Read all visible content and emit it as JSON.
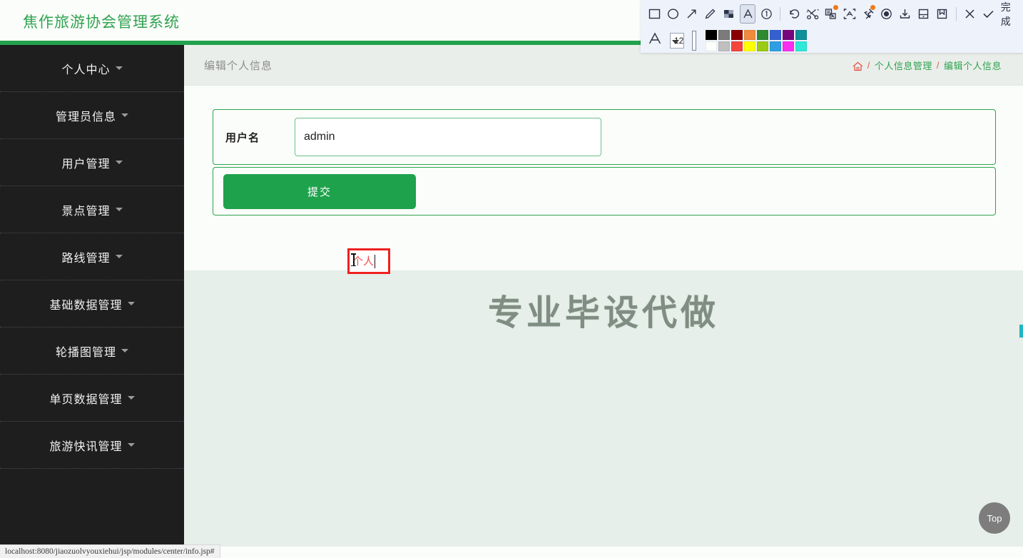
{
  "brand": {
    "title": "焦作旅游协会管理系统"
  },
  "sidebar": {
    "items": [
      {
        "label": "个人中心",
        "icon": "chevron-down-icon"
      },
      {
        "label": "管理员信息",
        "icon": "chevron-down-icon"
      },
      {
        "label": "用户管理",
        "icon": "chevron-down-icon"
      },
      {
        "label": "景点管理",
        "icon": "chevron-down-icon"
      },
      {
        "label": "路线管理",
        "icon": "chevron-down-icon"
      },
      {
        "label": "基础数据管理",
        "icon": "chevron-down-icon"
      },
      {
        "label": "轮播图管理",
        "icon": "chevron-down-icon"
      },
      {
        "label": "单页数据管理",
        "icon": "chevron-down-icon"
      },
      {
        "label": "旅游快讯管理",
        "icon": "chevron-down-icon"
      }
    ]
  },
  "page": {
    "title": "编辑个人信息",
    "breadcrumb": {
      "home_icon": "home-icon",
      "sep": "/",
      "items": [
        "个人信息管理",
        "编辑个人信息"
      ]
    }
  },
  "form": {
    "username": {
      "label": "用户名",
      "value": "admin",
      "placeholder": "用户名"
    },
    "submit_label": "提交"
  },
  "watermark": {
    "text": "专业毕设代做"
  },
  "top_button": {
    "label": "Top"
  },
  "statusbar": {
    "url": "localhost:8080/jiaozuolvyouxiehui/jsp/modules/center/info.jsp#"
  },
  "annotation": {
    "text": "个人",
    "color": "#f24b4b",
    "border_color": "#f02020"
  },
  "snip_toolbar": {
    "tools": [
      {
        "name": "rectangle-icon",
        "label": "矩形"
      },
      {
        "name": "ellipse-icon",
        "label": "椭圆"
      },
      {
        "name": "arrow-icon",
        "label": "箭头"
      },
      {
        "name": "pencil-icon",
        "label": "画笔"
      },
      {
        "name": "mosaic-icon",
        "label": "马赛克"
      },
      {
        "name": "text-icon",
        "label": "文字",
        "selected": true
      },
      {
        "name": "step-number-icon",
        "label": "序号"
      },
      {
        "name": "undo-icon",
        "label": "撤销"
      },
      {
        "name": "crop-scissors-icon",
        "label": "裁剪"
      },
      {
        "name": "ocr-icon",
        "label": "文字识别",
        "badge": true
      },
      {
        "name": "extract-text-icon",
        "label": "提取"
      },
      {
        "name": "pin-icon",
        "label": "钉住",
        "badge": true
      },
      {
        "name": "record-icon",
        "label": "录制"
      },
      {
        "name": "download-icon",
        "label": "下载"
      },
      {
        "name": "save-icon",
        "label": "保存"
      },
      {
        "name": "bookmark-icon",
        "label": "收藏"
      },
      {
        "name": "close-icon",
        "label": "关闭"
      },
      {
        "name": "check-icon",
        "label": "确认"
      }
    ],
    "done_label": "完成",
    "font_icon": "font-a-icon",
    "font_size": "12",
    "current_color": "#fa3c32",
    "palette_row1": [
      "#000000",
      "#7b7b7b",
      "#8b0000",
      "#f08b3c",
      "#2f8a32",
      "#3560d0",
      "#76067d",
      "#0d9099"
    ],
    "palette_row2": [
      "#fbfefb",
      "#bfbfbf",
      "#f4453c",
      "#ffff00",
      "#9bcb14",
      "#2f9ee3",
      "#f82ef0",
      "#2ee8d8"
    ]
  },
  "theme": {
    "brand_green": "#2fa350",
    "rule_green": "#23a24d",
    "sidebar_bg": "#1e1e1e",
    "tint_bg": "#e6efe9",
    "accent_red": "#e2574c"
  }
}
